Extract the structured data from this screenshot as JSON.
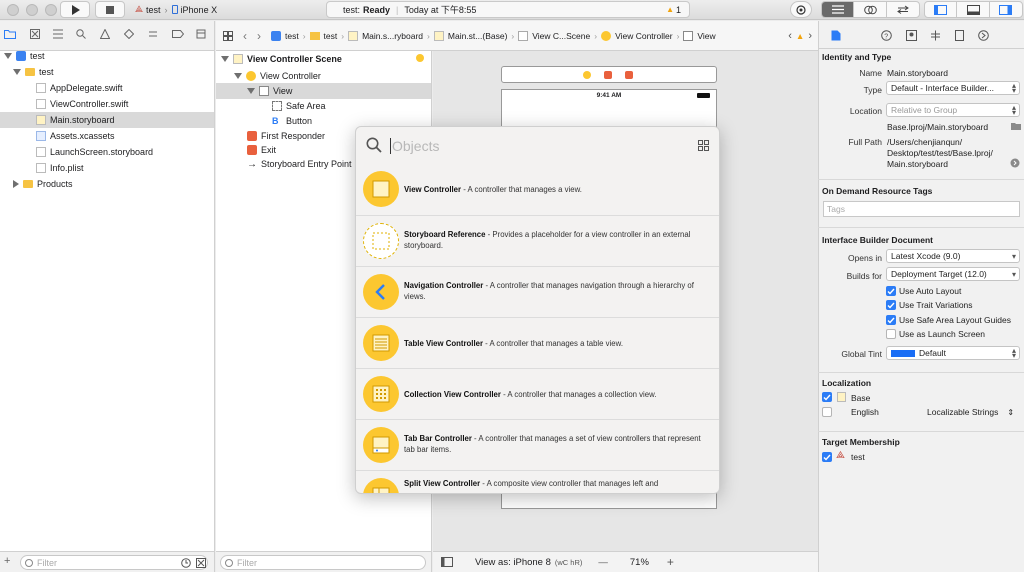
{
  "toolbar": {
    "scheme": "test",
    "device": "iPhone X",
    "status_project": "test:",
    "status_text": "Ready",
    "status_time": "Today at 下午8:55",
    "warning_count": "1"
  },
  "navigator": {
    "tree": [
      {
        "label": "test",
        "level": 0,
        "kind": "project",
        "expanded": true
      },
      {
        "label": "test",
        "level": 1,
        "kind": "folder",
        "expanded": true
      },
      {
        "label": "AppDelegate.swift",
        "level": 2,
        "kind": "swift"
      },
      {
        "label": "ViewController.swift",
        "level": 2,
        "kind": "swift"
      },
      {
        "label": "Main.storyboard",
        "level": 2,
        "kind": "storyboard",
        "selected": true
      },
      {
        "label": "Assets.xcassets",
        "level": 2,
        "kind": "assets"
      },
      {
        "label": "LaunchScreen.storyboard",
        "level": 2,
        "kind": "storyboard"
      },
      {
        "label": "Info.plist",
        "level": 2,
        "kind": "plist"
      },
      {
        "label": "Products",
        "level": 1,
        "kind": "folder",
        "expanded": false
      }
    ],
    "filter_placeholder": "Filter"
  },
  "jumpbar": {
    "crumbs": [
      "test",
      "test",
      "Main.s...ryboard",
      "Main.st...(Base)",
      "View C...Scene",
      "View Controller",
      "View"
    ]
  },
  "outline": {
    "items": [
      {
        "label": "View Controller Scene",
        "level": 0,
        "bold": true
      },
      {
        "label": "View Controller",
        "level": 1
      },
      {
        "label": "View",
        "level": 2,
        "selected": true
      },
      {
        "label": "Safe Area",
        "level": 3
      },
      {
        "label": "Button",
        "level": 3
      },
      {
        "label": "First Responder",
        "level": 1
      },
      {
        "label": "Exit",
        "level": 1
      },
      {
        "label": "Storyboard Entry Point",
        "level": 1
      }
    ],
    "filter_placeholder": "Filter"
  },
  "canvas": {
    "device_time": "9:41 AM",
    "view_as": "View as: iPhone 8",
    "size_class": "(wC hR)",
    "zoom": "71%",
    "zoom_minus": "—",
    "zoom_plus": "+"
  },
  "library": {
    "search_placeholder": "Objects",
    "items": [
      {
        "name": "View Controller",
        "desc": " - A controller that manages a view.",
        "icon": "view-controller"
      },
      {
        "name": "Storyboard Reference",
        "desc": " - Provides a placeholder for a view controller in an external storyboard.",
        "icon": "storyboard-reference"
      },
      {
        "name": "Navigation Controller",
        "desc": " - A controller that manages navigation through a hierarchy of views.",
        "icon": "navigation-controller"
      },
      {
        "name": "Table View Controller",
        "desc": " - A controller that manages a table view.",
        "icon": "table-view-controller"
      },
      {
        "name": "Collection View Controller",
        "desc": " - A controller that manages a collection view.",
        "icon": "collection-view-controller"
      },
      {
        "name": "Tab Bar Controller",
        "desc": " - A controller that manages a set of view controllers that represent tab bar items.",
        "icon": "tab-bar-controller"
      },
      {
        "name": "Split View Controller",
        "desc": " - A composite view controller that manages left and",
        "icon": "split-view-controller"
      }
    ]
  },
  "inspector": {
    "identity": {
      "section": "Identity and Type",
      "name_label": "Name",
      "name_value": "Main.storyboard",
      "type_label": "Type",
      "type_value": "Default - Interface Builder...",
      "location_label": "Location",
      "location_value": "Relative to Group",
      "location_path": "Base.lproj/Main.storyboard",
      "fullpath_label": "Full Path",
      "fullpath_lines": [
        "/Users/chenjianqun/",
        "Desktop/test/test/Base.lproj/",
        "Main.storyboard"
      ]
    },
    "on_demand": {
      "section": "On Demand Resource Tags",
      "tags_placeholder": "Tags"
    },
    "ib_document": {
      "section": "Interface Builder Document",
      "opens_in_label": "Opens in",
      "opens_in_value": "Latest Xcode (9.0)",
      "builds_for_label": "Builds for",
      "builds_for_value": "Deployment Target (12.0)",
      "checks": [
        {
          "label": "Use Auto Layout",
          "checked": true
        },
        {
          "label": "Use Trait Variations",
          "checked": true
        },
        {
          "label": "Use Safe Area Layout Guides",
          "checked": true
        },
        {
          "label": "Use as Launch Screen",
          "checked": false
        }
      ],
      "global_tint_label": "Global Tint",
      "global_tint_value": "Default",
      "tint_color": "#1a6ef5"
    },
    "localization": {
      "section": "Localization",
      "items": [
        {
          "label": "Base",
          "checked": true
        },
        {
          "label": "English",
          "checked": false,
          "value": "Localizable Strings"
        }
      ]
    },
    "target": {
      "section": "Target Membership",
      "items": [
        {
          "label": "test",
          "checked": true
        }
      ]
    }
  },
  "colors": {
    "accent": "#2b7cf6",
    "library_icon": "#fcc730",
    "warning": "#f2a40c"
  }
}
